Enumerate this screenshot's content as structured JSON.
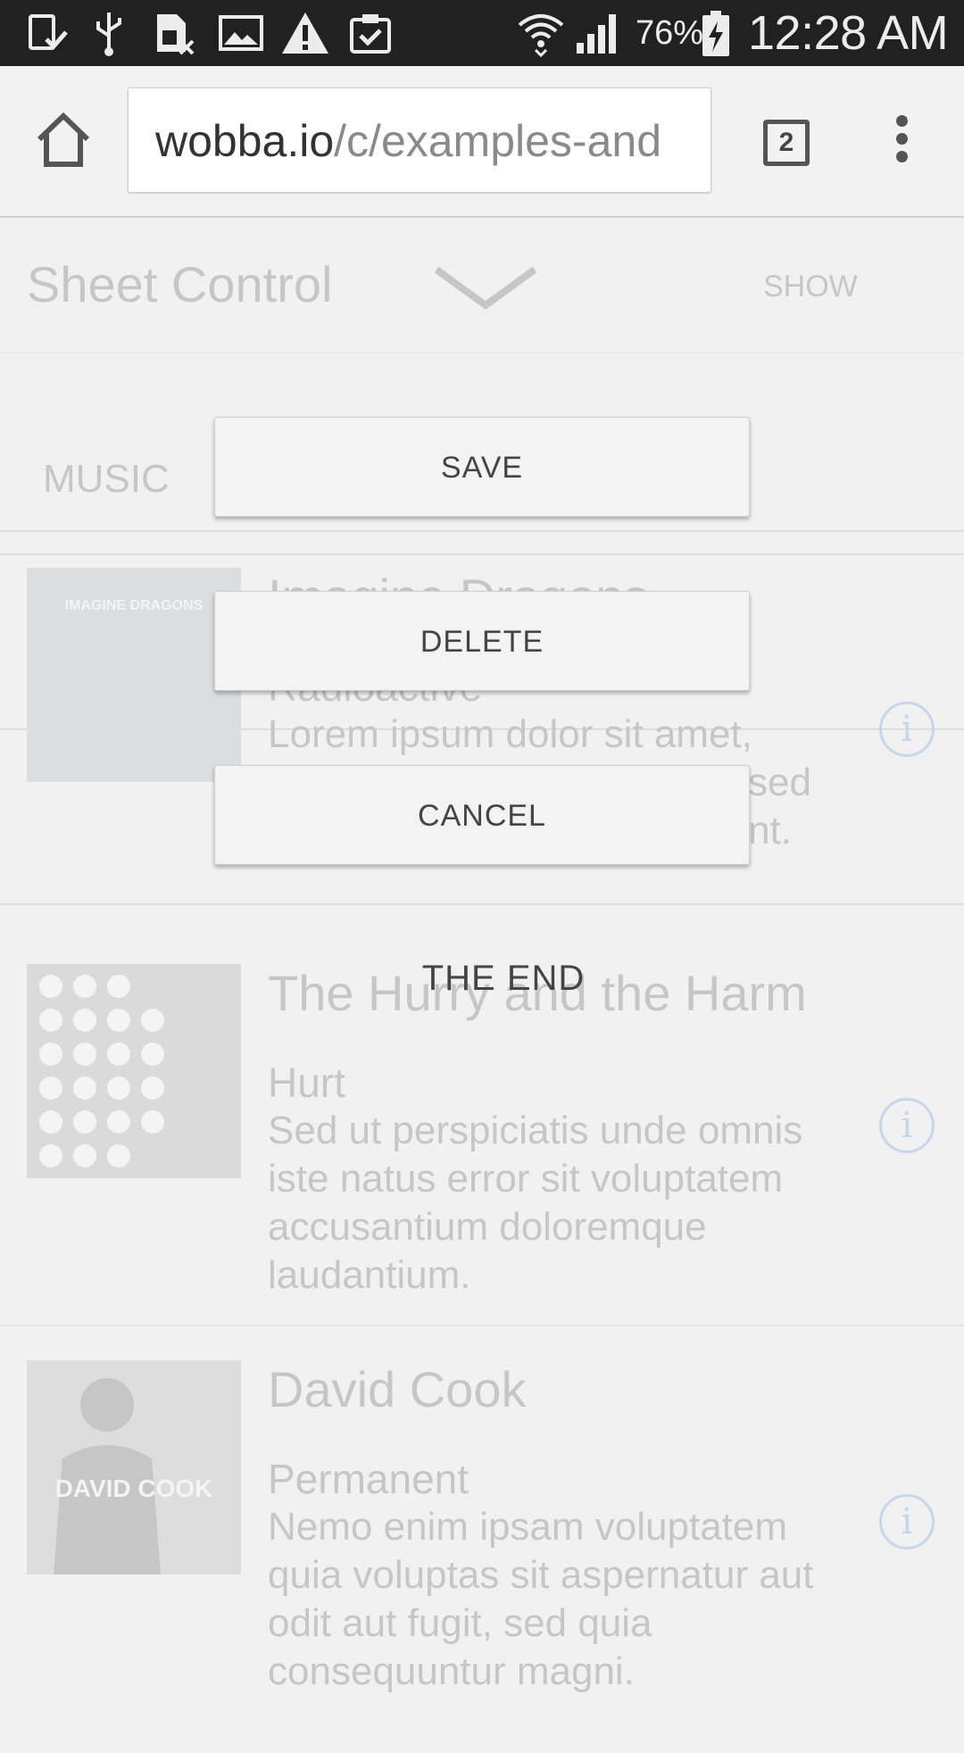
{
  "status_bar": {
    "battery_percent": "76%",
    "time": "12:28 AM",
    "icons": [
      "download-done-icon",
      "usb-icon",
      "sim-error-icon",
      "image-icon",
      "warning-icon",
      "clipboard-check-icon",
      "wifi-icon",
      "signal-icon",
      "battery-charging-icon"
    ]
  },
  "browser": {
    "url_host": "wobba.io",
    "url_path": "/c/examples-and",
    "tab_count": "2"
  },
  "sheet": {
    "title": "Sheet Control",
    "show_label": "SHOW",
    "section_label": "MUSIC"
  },
  "cards": [
    {
      "title": "Imagine Dragons",
      "album": "Radioactive",
      "description": "Lorem ipsum dolor sit amet, consectetur adipisicing elit, sed do eiusmod tempor incididunt.",
      "cover_text": "IMAGINE DRAGONS"
    },
    {
      "title": "The Hurry and the Harm",
      "album": "Hurt",
      "description": "Sed ut perspiciatis unde omnis iste natus error sit voluptatem accusantium doloremque laudantium.",
      "cover_text": ""
    },
    {
      "title": "David Cook",
      "album": "Permanent",
      "description": "Nemo enim ipsam voluptatem quia voluptas sit aspernatur aut odit aut fugit, sed quia consequuntur magni.",
      "cover_text": "DAVID COOK"
    }
  ],
  "actions": {
    "save_label": "SAVE",
    "delete_label": "DELETE",
    "cancel_label": "CANCEL",
    "end_label": "THE END"
  }
}
